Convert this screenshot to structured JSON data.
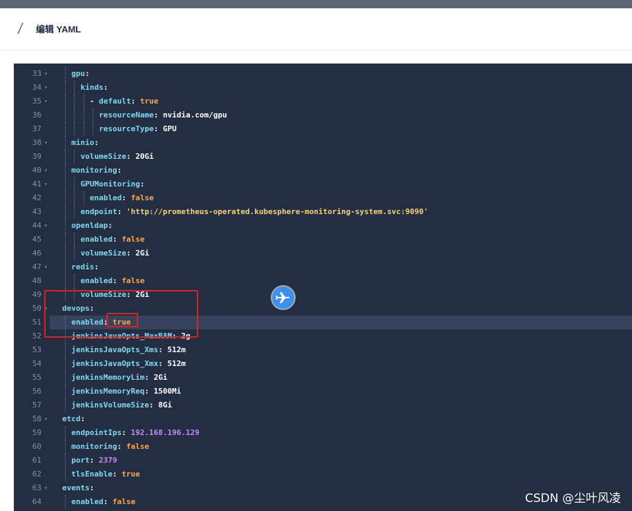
{
  "dialog": {
    "title": "编辑 YAML",
    "pen_icon": "pen-icon"
  },
  "watermark": "CSDN @尘叶风凌",
  "floating_button": {
    "icon": "airplane-icon"
  },
  "colors": {
    "editor_bg": "#242e42",
    "key": "#80d8f0",
    "string": "#f5d27a",
    "bool": "#f7a84a",
    "number": "#c58af9"
  },
  "editor": {
    "active_line": 51,
    "lines": [
      {
        "n": "33",
        "fold": true,
        "depth": 1,
        "seg": [
          [
            "k",
            "gpu"
          ],
          [
            "p",
            ":"
          ]
        ]
      },
      {
        "n": "34",
        "fold": true,
        "depth": 2,
        "seg": [
          [
            "k",
            "kinds"
          ],
          [
            "p",
            ":"
          ]
        ]
      },
      {
        "n": "35",
        "fold": true,
        "depth": 3,
        "seg": [
          [
            "p",
            "- "
          ],
          [
            "k",
            "default"
          ],
          [
            "p",
            ": "
          ],
          [
            "b",
            "true"
          ]
        ]
      },
      {
        "n": "36",
        "fold": false,
        "depth": 4,
        "seg": [
          [
            "k",
            "resourceName"
          ],
          [
            "p",
            ": "
          ],
          [
            "p",
            "nvidia.com/gpu"
          ]
        ]
      },
      {
        "n": "37",
        "fold": false,
        "depth": 4,
        "seg": [
          [
            "k",
            "resourceType"
          ],
          [
            "p",
            ": "
          ],
          [
            "p",
            "GPU"
          ]
        ]
      },
      {
        "n": "38",
        "fold": true,
        "depth": 1,
        "seg": [
          [
            "k",
            "minio"
          ],
          [
            "p",
            ":"
          ]
        ]
      },
      {
        "n": "39",
        "fold": false,
        "depth": 2,
        "seg": [
          [
            "k",
            "volumeSize"
          ],
          [
            "p",
            ": "
          ],
          [
            "p",
            "20Gi"
          ]
        ]
      },
      {
        "n": "40",
        "fold": true,
        "depth": 1,
        "seg": [
          [
            "k",
            "monitoring"
          ],
          [
            "p",
            ":"
          ]
        ]
      },
      {
        "n": "41",
        "fold": true,
        "depth": 2,
        "seg": [
          [
            "k",
            "GPUMonitoring"
          ],
          [
            "p",
            ":"
          ]
        ]
      },
      {
        "n": "42",
        "fold": false,
        "depth": 3,
        "seg": [
          [
            "k",
            "enabled"
          ],
          [
            "p",
            ": "
          ],
          [
            "b",
            "false"
          ]
        ]
      },
      {
        "n": "43",
        "fold": false,
        "depth": 2,
        "seg": [
          [
            "k",
            "endpoint"
          ],
          [
            "p",
            ": "
          ],
          [
            "s",
            "'http://prometheus-operated.kubesphere-monitoring-system.svc:9090'"
          ]
        ]
      },
      {
        "n": "44",
        "fold": true,
        "depth": 1,
        "seg": [
          [
            "k",
            "openldap"
          ],
          [
            "p",
            ":"
          ]
        ]
      },
      {
        "n": "45",
        "fold": false,
        "depth": 2,
        "seg": [
          [
            "k",
            "enabled"
          ],
          [
            "p",
            ": "
          ],
          [
            "b",
            "false"
          ]
        ]
      },
      {
        "n": "46",
        "fold": false,
        "depth": 2,
        "seg": [
          [
            "k",
            "volumeSize"
          ],
          [
            "p",
            ": "
          ],
          [
            "p",
            "2Gi"
          ]
        ]
      },
      {
        "n": "47",
        "fold": true,
        "depth": 1,
        "seg": [
          [
            "k",
            "redis"
          ],
          [
            "p",
            ":"
          ]
        ]
      },
      {
        "n": "48",
        "fold": false,
        "depth": 2,
        "seg": [
          [
            "k",
            "enabled"
          ],
          [
            "p",
            ": "
          ],
          [
            "b",
            "false"
          ]
        ]
      },
      {
        "n": "49",
        "fold": false,
        "depth": 2,
        "seg": [
          [
            "k",
            "volumeSize"
          ],
          [
            "p",
            ": "
          ],
          [
            "p",
            "2Gi"
          ]
        ]
      },
      {
        "n": "50",
        "fold": true,
        "depth": 0,
        "seg": [
          [
            "k",
            "devops"
          ],
          [
            "p",
            ":"
          ]
        ]
      },
      {
        "n": "51",
        "fold": false,
        "depth": 1,
        "seg": [
          [
            "k",
            "enabled"
          ],
          [
            "p",
            ": "
          ],
          [
            "b",
            "true"
          ]
        ]
      },
      {
        "n": "52",
        "fold": false,
        "depth": 1,
        "seg": [
          [
            "k",
            "jenkinsJavaOpts_MaxRAM"
          ],
          [
            "p",
            ": "
          ],
          [
            "p",
            "2g"
          ]
        ]
      },
      {
        "n": "53",
        "fold": false,
        "depth": 1,
        "seg": [
          [
            "k",
            "jenkinsJavaOpts_Xms"
          ],
          [
            "p",
            ": "
          ],
          [
            "p",
            "512m"
          ]
        ]
      },
      {
        "n": "54",
        "fold": false,
        "depth": 1,
        "seg": [
          [
            "k",
            "jenkinsJavaOpts_Xmx"
          ],
          [
            "p",
            ": "
          ],
          [
            "p",
            "512m"
          ]
        ]
      },
      {
        "n": "55",
        "fold": false,
        "depth": 1,
        "seg": [
          [
            "k",
            "jenkinsMemoryLim"
          ],
          [
            "p",
            ": "
          ],
          [
            "p",
            "2Gi"
          ]
        ]
      },
      {
        "n": "56",
        "fold": false,
        "depth": 1,
        "seg": [
          [
            "k",
            "jenkinsMemoryReq"
          ],
          [
            "p",
            ": "
          ],
          [
            "p",
            "1500Mi"
          ]
        ]
      },
      {
        "n": "57",
        "fold": false,
        "depth": 1,
        "seg": [
          [
            "k",
            "jenkinsVolumeSize"
          ],
          [
            "p",
            ": "
          ],
          [
            "p",
            "8Gi"
          ]
        ]
      },
      {
        "n": "58",
        "fold": true,
        "depth": 0,
        "seg": [
          [
            "k",
            "etcd"
          ],
          [
            "p",
            ":"
          ]
        ]
      },
      {
        "n": "59",
        "fold": false,
        "depth": 1,
        "seg": [
          [
            "k",
            "endpointIps"
          ],
          [
            "p",
            ": "
          ],
          [
            "n",
            "192.168.196.129"
          ]
        ]
      },
      {
        "n": "60",
        "fold": false,
        "depth": 1,
        "seg": [
          [
            "k",
            "monitoring"
          ],
          [
            "p",
            ": "
          ],
          [
            "b",
            "false"
          ]
        ]
      },
      {
        "n": "61",
        "fold": false,
        "depth": 1,
        "seg": [
          [
            "k",
            "port"
          ],
          [
            "p",
            ": "
          ],
          [
            "n",
            "2379"
          ]
        ]
      },
      {
        "n": "62",
        "fold": false,
        "depth": 1,
        "seg": [
          [
            "k",
            "tlsEnable"
          ],
          [
            "p",
            ": "
          ],
          [
            "b",
            "true"
          ]
        ]
      },
      {
        "n": "63",
        "fold": true,
        "depth": 0,
        "seg": [
          [
            "k",
            "events"
          ],
          [
            "p",
            ":"
          ]
        ]
      },
      {
        "n": "64",
        "fold": false,
        "depth": 1,
        "seg": [
          [
            "k",
            "enabled"
          ],
          [
            "p",
            ": "
          ],
          [
            "b",
            "false"
          ]
        ]
      }
    ]
  }
}
